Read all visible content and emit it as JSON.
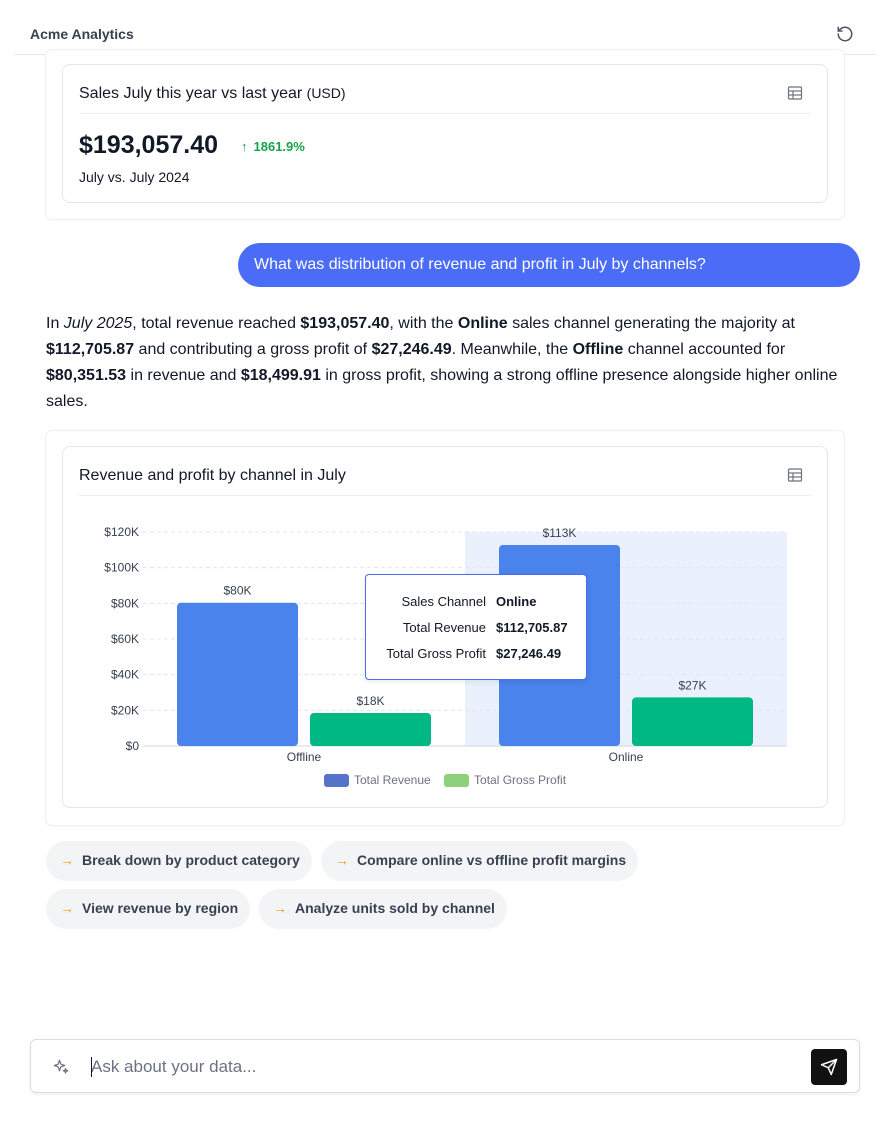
{
  "header": {
    "app_title": "Acme Analytics",
    "reset_icon": "rotate-ccw-icon"
  },
  "kpi_card": {
    "title": "Sales July this year vs last year",
    "unit": "(USD)",
    "value": "$193,057.40",
    "change_arrow": "↑",
    "change": "1861.9%",
    "subtitle": "July vs. July 2024",
    "table_icon": "table-icon"
  },
  "user_message": "What was distribution of revenue and profit in July by channels?",
  "answer": {
    "s1": "In ",
    "s2": "July 2025",
    "s3": ", total revenue reached ",
    "s4": "$193,057.40",
    "s5": ", with the ",
    "s6": "Online",
    "s7": " sales channel generating the majority at ",
    "s8": "$112,705.87",
    "s9": " and contributing a gross profit of ",
    "s10": "$27,246.49",
    "s11": ". Meanwhile, the ",
    "s12": "Offline",
    "s13": " channel accounted for ",
    "s14": "$80,351.53",
    "s15": " in revenue and ",
    "s16": "$18,499.91",
    "s17": " in gross profit, showing a strong offline presence alongside higher online sales."
  },
  "chart_card": {
    "title": "Revenue and profit by channel in July",
    "table_icon": "table-icon"
  },
  "chart_data": {
    "type": "bar",
    "title": "Revenue and profit by channel in July",
    "categories": [
      "Offline",
      "Online"
    ],
    "series": [
      {
        "name": "Total Revenue",
        "values": [
          80351.53,
          112705.87
        ],
        "labels": [
          "$80K",
          "$113K"
        ],
        "color": "#4a83ec"
      },
      {
        "name": "Total Gross Profit",
        "values": [
          18499.91,
          27246.49
        ],
        "labels": [
          "$18K",
          "$27K"
        ],
        "color": "#00b884"
      }
    ],
    "legend_colors": [
      "#5574c9",
      "#8fd17b"
    ],
    "y_ticks": [
      "$0",
      "$20K",
      "$40K",
      "$60K",
      "$80K",
      "$100K",
      "$120K"
    ],
    "ylim": [
      0,
      120000
    ],
    "grid": true,
    "legend_position": "bottom-center",
    "highlighted_category": "Online",
    "tooltip": {
      "rows": [
        {
          "label": "Sales Channel",
          "value": "Online"
        },
        {
          "label": "Total Revenue",
          "value": "$112,705.87"
        },
        {
          "label": "Total Gross Profit",
          "value": "$27,246.49"
        }
      ]
    }
  },
  "suggestions": [
    "Break down by product category",
    "Compare online vs offline profit margins",
    "View revenue by region",
    "Analyze units sold by channel"
  ],
  "suggestion_icon": "arrow-right-icon",
  "composer": {
    "placeholder": "Ask about your data...",
    "value": "",
    "sparkle_icon": "sparkles-icon",
    "send_icon": "send-icon"
  }
}
